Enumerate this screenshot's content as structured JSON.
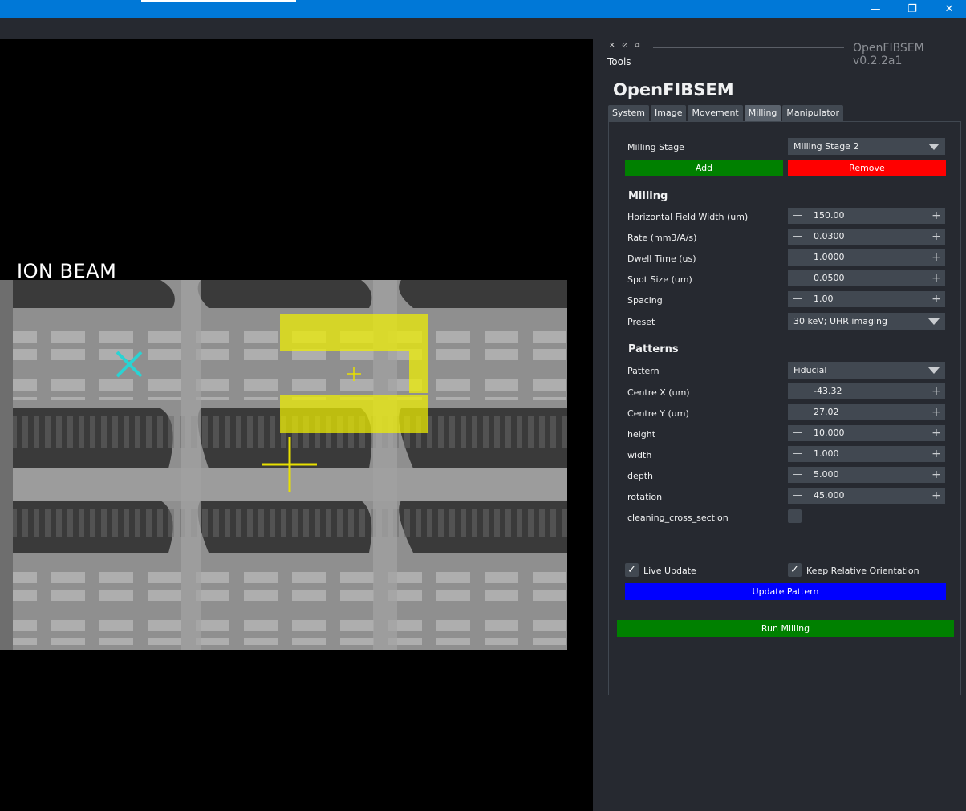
{
  "window": {
    "controls": {
      "minimize": "—",
      "restore": "❐",
      "close": "✕"
    }
  },
  "viewer": {
    "beam_label": "ION BEAM"
  },
  "dock": {
    "buttons": {
      "close": "✕",
      "float": "⊘",
      "dock": "⧉"
    },
    "title": "OpenFIBSEM v0.2.2a1",
    "tools_label": "Tools"
  },
  "app": {
    "title": "OpenFIBSEM",
    "tabs": [
      {
        "label": "System"
      },
      {
        "label": "Image"
      },
      {
        "label": "Movement"
      },
      {
        "label": "Milling"
      },
      {
        "label": "Manipulator"
      }
    ],
    "active_tab": "Milling"
  },
  "milling": {
    "stage_label": "Milling Stage",
    "stage_value": "Milling Stage 2",
    "add_label": "Add",
    "remove_label": "Remove",
    "section_title": "Milling",
    "hfw": {
      "label": "Horizontal Field Width (um)",
      "value": "150.00"
    },
    "rate": {
      "label": "Rate (mm3/A/s)",
      "value": "0.0300"
    },
    "dwell": {
      "label": "Dwell Time (us)",
      "value": "1.0000"
    },
    "spot": {
      "label": "Spot Size (um)",
      "value": "0.0500"
    },
    "spacing": {
      "label": "Spacing",
      "value": "1.00"
    },
    "preset": {
      "label": "Preset",
      "value": "30 keV; UHR imaging"
    }
  },
  "patterns": {
    "section_title": "Patterns",
    "pattern": {
      "label": "Pattern",
      "value": "Fiducial"
    },
    "centre_x": {
      "label": "Centre X (um)",
      "value": "-43.32"
    },
    "centre_y": {
      "label": "Centre Y (um)",
      "value": "27.02"
    },
    "height": {
      "label": "height",
      "value": "10.000"
    },
    "width": {
      "label": "width",
      "value": "1.000"
    },
    "depth": {
      "label": "depth",
      "value": "5.000"
    },
    "rotation": {
      "label": "rotation",
      "value": "45.000"
    },
    "cleaning": {
      "label": "cleaning_cross_section",
      "checked": false
    }
  },
  "controls": {
    "live_update": {
      "label": "Live Update",
      "checked": true
    },
    "keep_orientation": {
      "label": "Keep Relative Orientation",
      "checked": true
    },
    "update_pattern_label": "Update Pattern",
    "run_milling_label": "Run Milling"
  },
  "spin_glyphs": {
    "minus": "—",
    "plus": "+"
  },
  "check_glyph": "✓",
  "colors": {
    "title_bar": "#0078d7",
    "add_button": "#008000",
    "remove_button": "#ff0000",
    "update_button": "#0000ff",
    "run_button": "#008000",
    "pattern_overlay": "#f0f000",
    "point_marker": "#2ad3d3"
  }
}
